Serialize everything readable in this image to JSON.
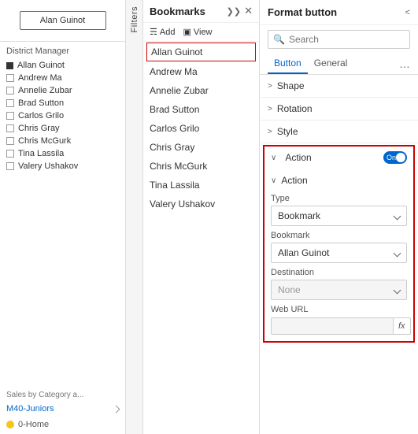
{
  "leftPanel": {
    "buttonLabel": "Alan Guinot",
    "districtManagerTitle": "District Manager",
    "items": [
      {
        "name": "Allan Guinot",
        "type": "filled"
      },
      {
        "name": "Andrew Ma",
        "type": "checkbox"
      },
      {
        "name": "Annelie Zubar",
        "type": "checkbox"
      },
      {
        "name": "Brad Sutton",
        "type": "checkbox"
      },
      {
        "name": "Carlos Grilo",
        "type": "checkbox"
      },
      {
        "name": "Chris Gray",
        "type": "checkbox"
      },
      {
        "name": "Chris McGurk",
        "type": "checkbox"
      },
      {
        "name": "Tina Lassila",
        "type": "checkbox"
      },
      {
        "name": "Valery Ushakov",
        "type": "checkbox"
      }
    ],
    "salesText": "Sales by Category a...",
    "m40Label": "M40-Juniors",
    "uHomeLabel": "0-Home"
  },
  "filtersTab": {
    "label": "Filters"
  },
  "bookmarks": {
    "title": "Bookmarks",
    "addLabel": "Add",
    "viewLabel": "View",
    "selectedItem": "Allan Guinot",
    "items": [
      "Allan Guinot",
      "Andrew Ma",
      "Annelie Zubar",
      "Brad Sutton",
      "Carlos Grilo",
      "Chris Gray",
      "Chris McGurk",
      "Tina Lassila",
      "Valery Ushakov"
    ]
  },
  "formatButton": {
    "title": "Format button",
    "search": {
      "placeholder": "Search"
    },
    "tabs": [
      {
        "label": "Button",
        "active": true
      },
      {
        "label": "General",
        "active": false
      }
    ],
    "sections": {
      "shape": "Shape",
      "rotation": "Rotation",
      "style": "Style",
      "action": "Action",
      "toggleLabel": "On",
      "subAction": "Action",
      "typeLabel": "Type",
      "typeValue": "Bookmark",
      "bookmarkLabel": "Bookmark",
      "bookmarkValue": "Allan Guinot",
      "destinationLabel": "Destination",
      "destinationValue": "None",
      "webUrlLabel": "Web URL",
      "fxLabel": "fx"
    }
  }
}
